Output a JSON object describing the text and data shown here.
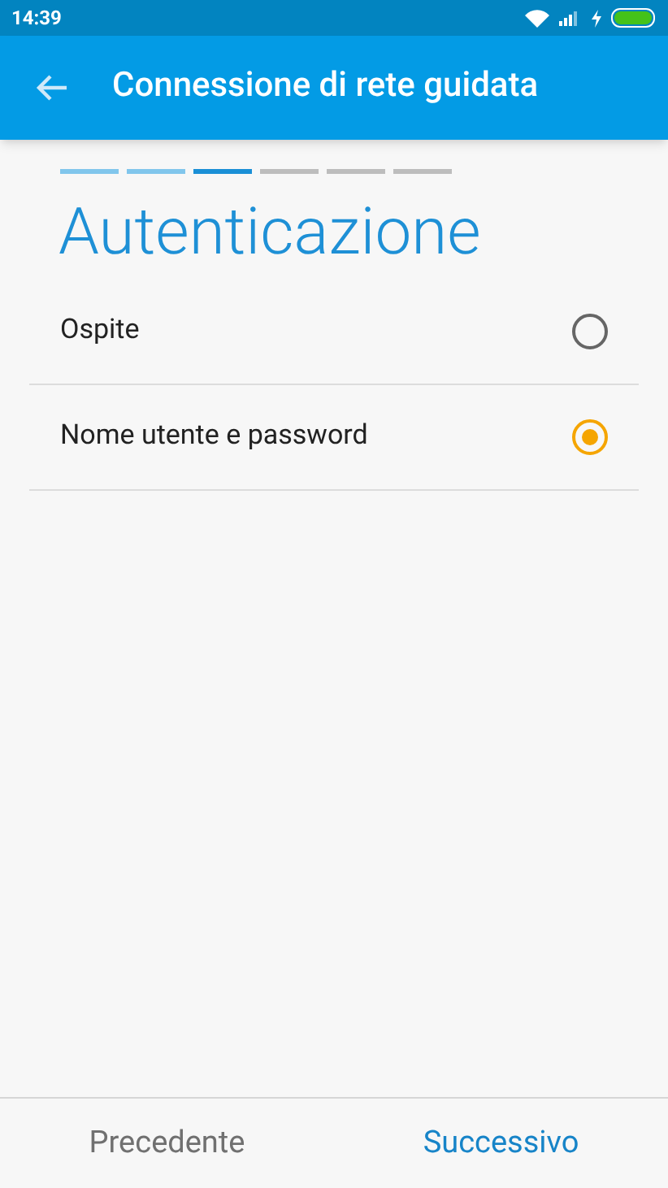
{
  "status_bar": {
    "time": "14:39"
  },
  "app_bar": {
    "title": "Connessione di rete guidata"
  },
  "steps": [
    {
      "kind": "done"
    },
    {
      "kind": "done"
    },
    {
      "kind": "current"
    },
    {
      "kind": "todo"
    },
    {
      "kind": "todo"
    },
    {
      "kind": "todo"
    }
  ],
  "heading": "Autenticazione",
  "options": [
    {
      "label": "Ospite",
      "selected": false
    },
    {
      "label": "Nome utente e password",
      "selected": true
    }
  ],
  "footer": {
    "back": "Precedente",
    "next": "Successivo"
  }
}
